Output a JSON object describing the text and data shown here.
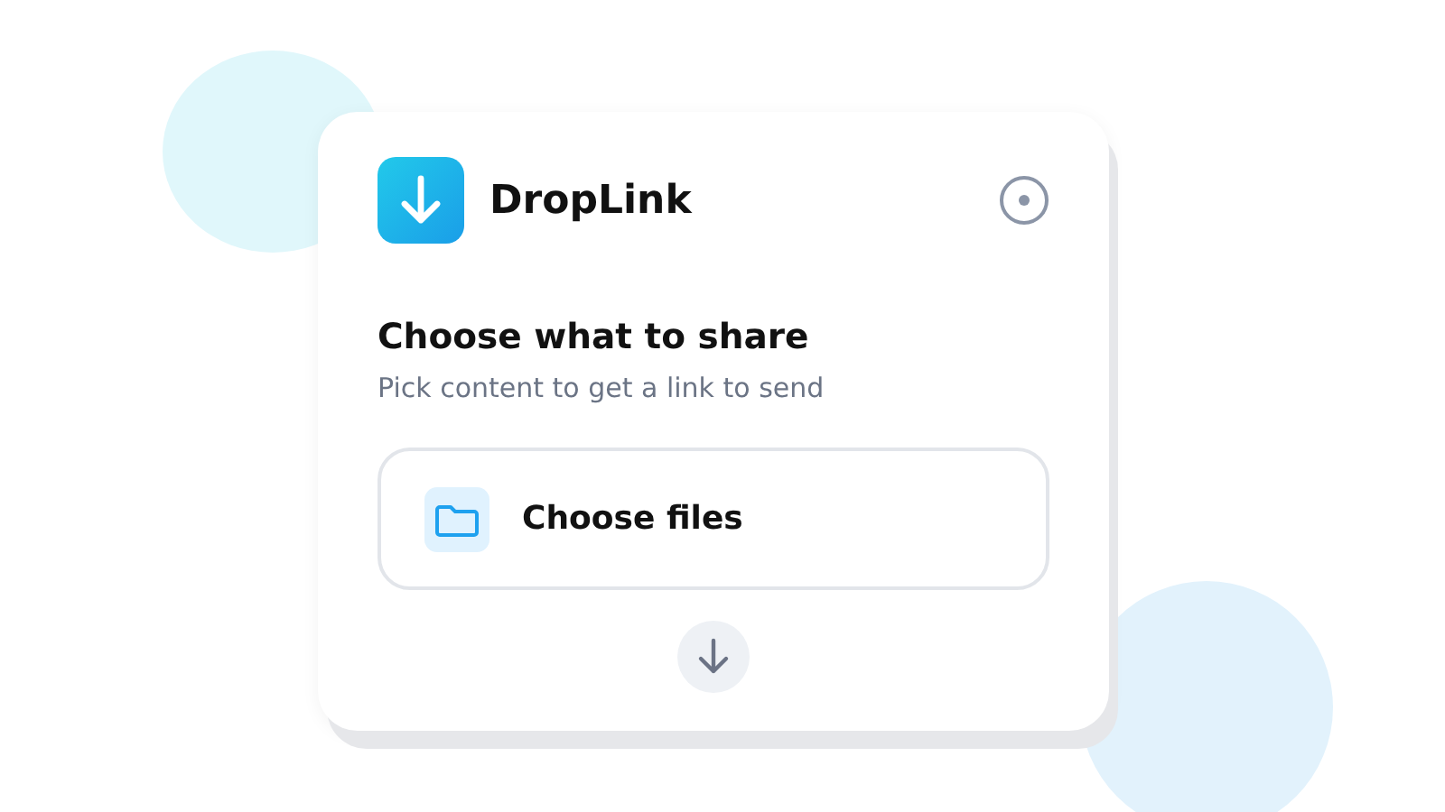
{
  "app": {
    "name": "DropLink"
  },
  "heading": "Choose what to share",
  "subtitle": "Pick content to get a link to send",
  "options": [
    {
      "label": "Choose files",
      "kind": "files"
    }
  ]
}
